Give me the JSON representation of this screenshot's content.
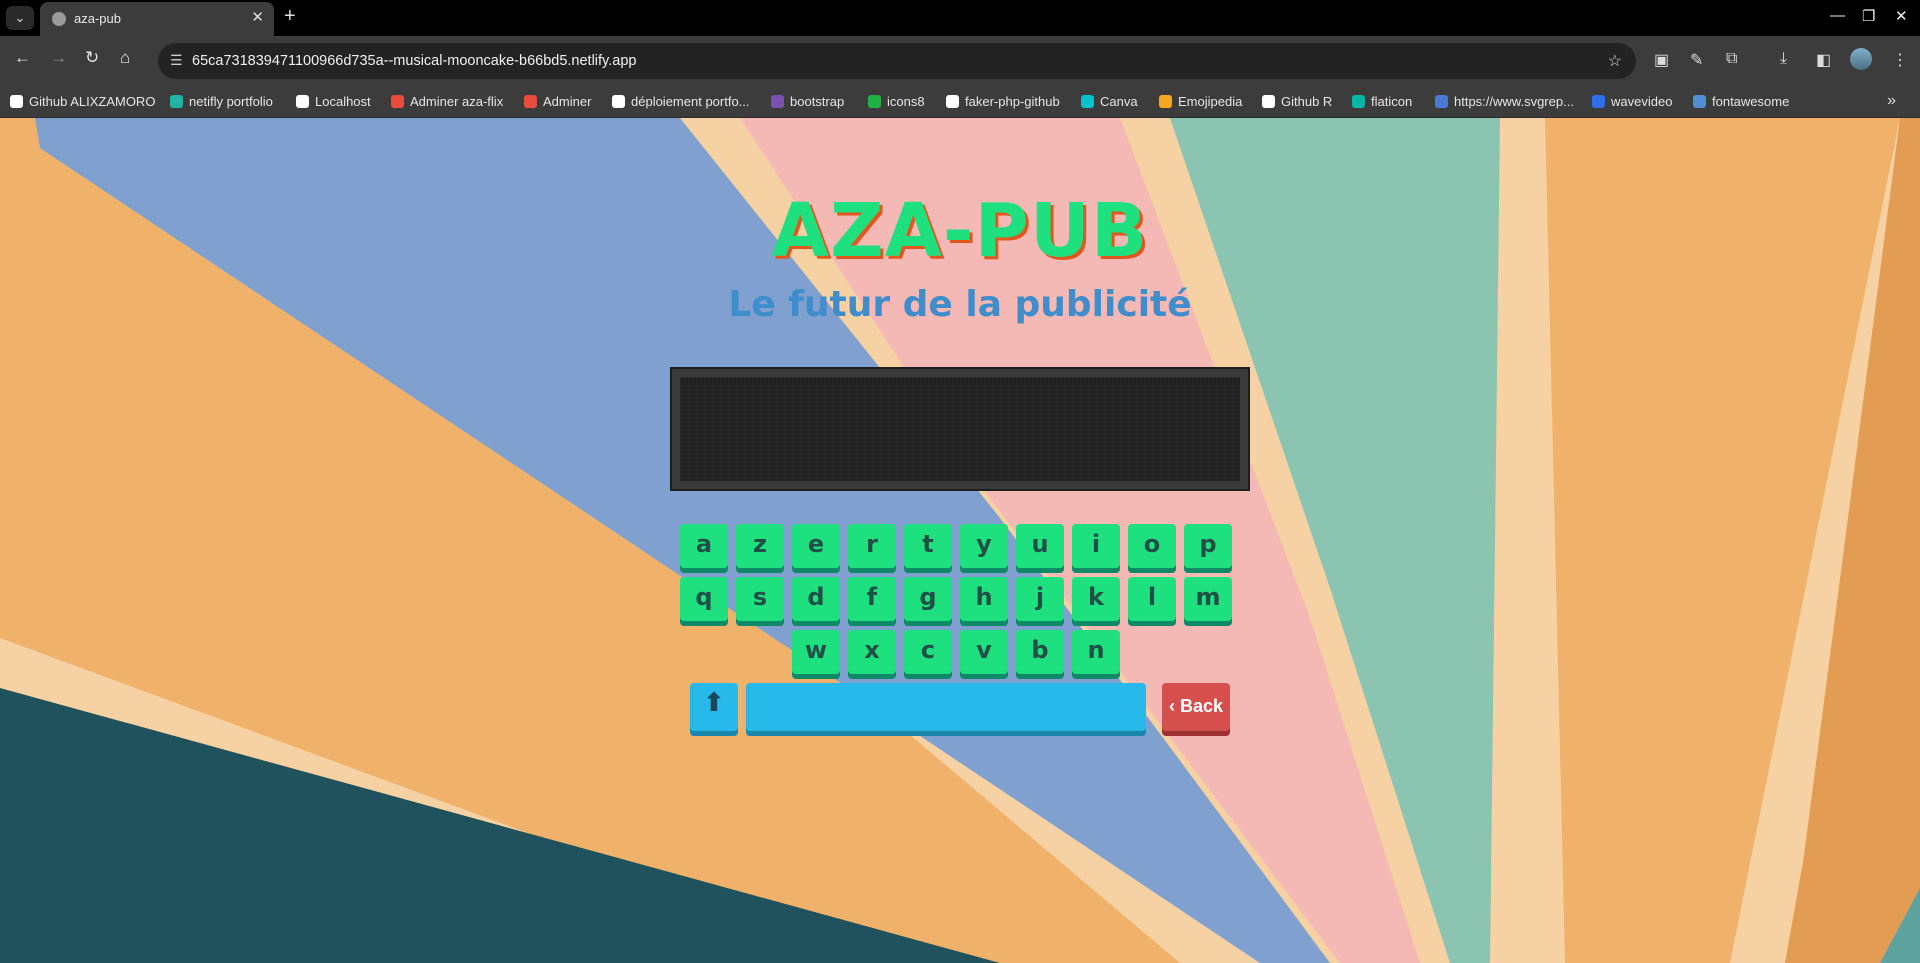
{
  "browser": {
    "tab_title": "aza-pub",
    "url": "65ca731839471100966d735a--musical-mooncake-b66bd5.netlify.app",
    "bookmarks": [
      {
        "label": "Github ALIXZAMORO",
        "color": "#ffffff"
      },
      {
        "label": "netifly portfolio",
        "color": "#20b4a5"
      },
      {
        "label": "Localhost",
        "color": "#ffffff"
      },
      {
        "label": "Adminer aza-flix",
        "color": "#e74c3c"
      },
      {
        "label": "Adminer",
        "color": "#e74c3c"
      },
      {
        "label": "déploiement portfo...",
        "color": "#ffffff"
      },
      {
        "label": "bootstrap",
        "color": "#7952b3"
      },
      {
        "label": "icons8",
        "color": "#1fb141"
      },
      {
        "label": "faker-php-github",
        "color": "#ffffff"
      },
      {
        "label": "Canva",
        "color": "#00c4cc"
      },
      {
        "label": "Emojipedia",
        "color": "#f5a623"
      },
      {
        "label": "Github R",
        "color": "#ffffff"
      },
      {
        "label": "flaticon",
        "color": "#0bb5a6"
      },
      {
        "label": "https://www.svgrep...",
        "color": "#4a79d6"
      },
      {
        "label": "wavevideo",
        "color": "#2f6fea"
      },
      {
        "label": "fontawesome",
        "color": "#538dd7"
      }
    ]
  },
  "page": {
    "brand": "AZA-PUB",
    "tagline": "Le futur de la publicité",
    "screen_text": "",
    "keyboard": {
      "row1": [
        "a",
        "z",
        "e",
        "r",
        "t",
        "y",
        "u",
        "i",
        "o",
        "p"
      ],
      "row2": [
        "q",
        "s",
        "d",
        "f",
        "g",
        "h",
        "j",
        "k",
        "l",
        "m"
      ],
      "row3": [
        "w",
        "x",
        "c",
        "v",
        "b",
        "n"
      ],
      "shift_label": "⬆",
      "space_label": "",
      "back_label": "‹ Back"
    }
  },
  "colors": {
    "brand_green": "#1ee07f",
    "brand_shadow": "#e0581e",
    "tagline_blue": "#3f8dca",
    "key_blue": "#27b9ea",
    "key_red": "#d54f4f"
  }
}
